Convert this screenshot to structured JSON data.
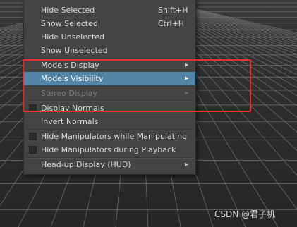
{
  "menu": {
    "items": [
      {
        "label": "Hide Selected",
        "shortcut": "Shift+H",
        "has_check": false,
        "has_submenu": false,
        "state": "normal"
      },
      {
        "label": "Show Selected",
        "shortcut": "Ctrl+H",
        "has_check": false,
        "has_submenu": false,
        "state": "normal"
      },
      {
        "label": "Hide Unselected",
        "shortcut": "",
        "has_check": false,
        "has_submenu": false,
        "state": "normal"
      },
      {
        "label": "Show Unselected",
        "shortcut": "",
        "has_check": false,
        "has_submenu": false,
        "state": "normal"
      },
      {
        "label": "Models Display",
        "shortcut": "",
        "has_check": false,
        "has_submenu": true,
        "state": "normal"
      },
      {
        "label": "Models Visibility",
        "shortcut": "",
        "has_check": false,
        "has_submenu": true,
        "state": "highlighted"
      },
      {
        "label": "Stereo Display",
        "shortcut": "",
        "has_check": false,
        "has_submenu": true,
        "state": "disabled"
      },
      {
        "label": "Display Normals",
        "shortcut": "",
        "has_check": true,
        "checked": false,
        "has_submenu": false,
        "state": "normal"
      },
      {
        "label": "Invert Normals",
        "shortcut": "",
        "has_check": false,
        "has_submenu": false,
        "state": "normal"
      },
      {
        "label": "Hide Manipulators while Manipulating",
        "shortcut": "",
        "has_check": true,
        "checked": false,
        "has_submenu": false,
        "state": "normal"
      },
      {
        "label": "Hide Manipulators during Playback",
        "shortcut": "",
        "has_check": true,
        "checked": false,
        "has_submenu": false,
        "state": "normal"
      },
      {
        "label": "Head-up Display (HUD)",
        "shortcut": "",
        "has_check": false,
        "has_submenu": true,
        "state": "normal"
      }
    ],
    "submenu_arrow": "▶"
  },
  "annotation": {
    "box_color": "#e8312a"
  },
  "watermark": {
    "text": "CSDN @君子机"
  },
  "colors": {
    "menu_background": "#444444",
    "highlight": "#5285a6",
    "menu_text": "#dadada",
    "disabled_text": "#7a7a7a",
    "viewport_grid": "#6b6b6b"
  }
}
